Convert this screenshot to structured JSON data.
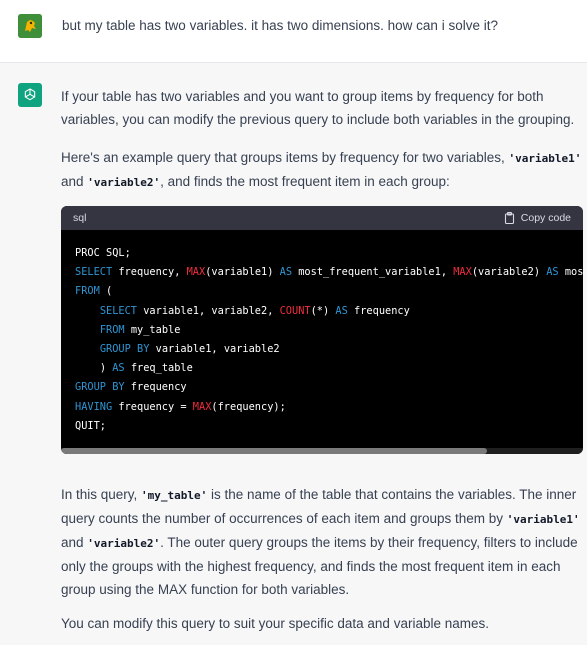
{
  "user_message": {
    "text": "but my table has two variables. it has two dimensions. how can i solve it?"
  },
  "assistant_message": {
    "p1": "If your table has two variables and you want to group items by frequency for both variables, you can modify the previous query to include both variables in the grouping.",
    "p2_a": "Here's an example query that groups items by frequency for two variables, ",
    "p2_code1": "'variable1'",
    "p2_b": " and ",
    "p2_code2": "'variable2'",
    "p2_c": ", and finds the most frequent item in each group:",
    "code_block": {
      "language": "sql",
      "copy_label": "Copy code",
      "lines": {
        "l1": "PROC SQL;",
        "l2_select": "SELECT",
        "l2_a": " frequency, ",
        "l2_max1": "MAX",
        "l2_b": "(variable1) ",
        "l2_as": "AS",
        "l2_c": " most_frequent_variable1, ",
        "l2_max2": "MAX",
        "l2_d": "(variable2) ",
        "l2_as2": "AS",
        "l2_e": " most_f",
        "l3_from": "FROM",
        "l3_a": " (",
        "l4_select": "SELECT",
        "l4_a": " variable1, variable2, ",
        "l4_count": "COUNT",
        "l4_b": "(*) ",
        "l4_as": "AS",
        "l4_c": " frequency",
        "l5_from": "FROM",
        "l5_a": " my_table",
        "l6_group": "GROUP BY",
        "l6_a": " variable1, variable2",
        "l7_a": ") ",
        "l7_as": "AS",
        "l7_b": " freq_table",
        "l8_group": "GROUP BY",
        "l8_a": " frequency",
        "l9_having": "HAVING",
        "l9_a": " frequency = ",
        "l9_max": "MAX",
        "l9_b": "(frequency);",
        "l10": "QUIT;"
      }
    },
    "p3_a": "In this query, ",
    "p3_code1": "'my_table'",
    "p3_b": " is the name of the table that contains the variables. The inner query counts the number of occurrences of each item and groups them by ",
    "p3_code2": "'variable1'",
    "p3_c": " and ",
    "p3_code3": "'variable2'",
    "p3_d": ". The outer query groups the items by their frequency, filters to include only the groups with the highest frequency, and finds the most frequent item in each group using the MAX function for both variables.",
    "p4": "You can modify this query to suit your specific data and variable names."
  },
  "colors": {
    "keyword": "#2e95d3",
    "function": "#f22c3d",
    "assistant_bg": "#f7f7f8",
    "openai_green": "#10a37f"
  },
  "icons": {
    "user_avatar": "user-avatar-icon",
    "assistant_avatar": "openai-logo-icon",
    "copy": "clipboard-icon"
  }
}
